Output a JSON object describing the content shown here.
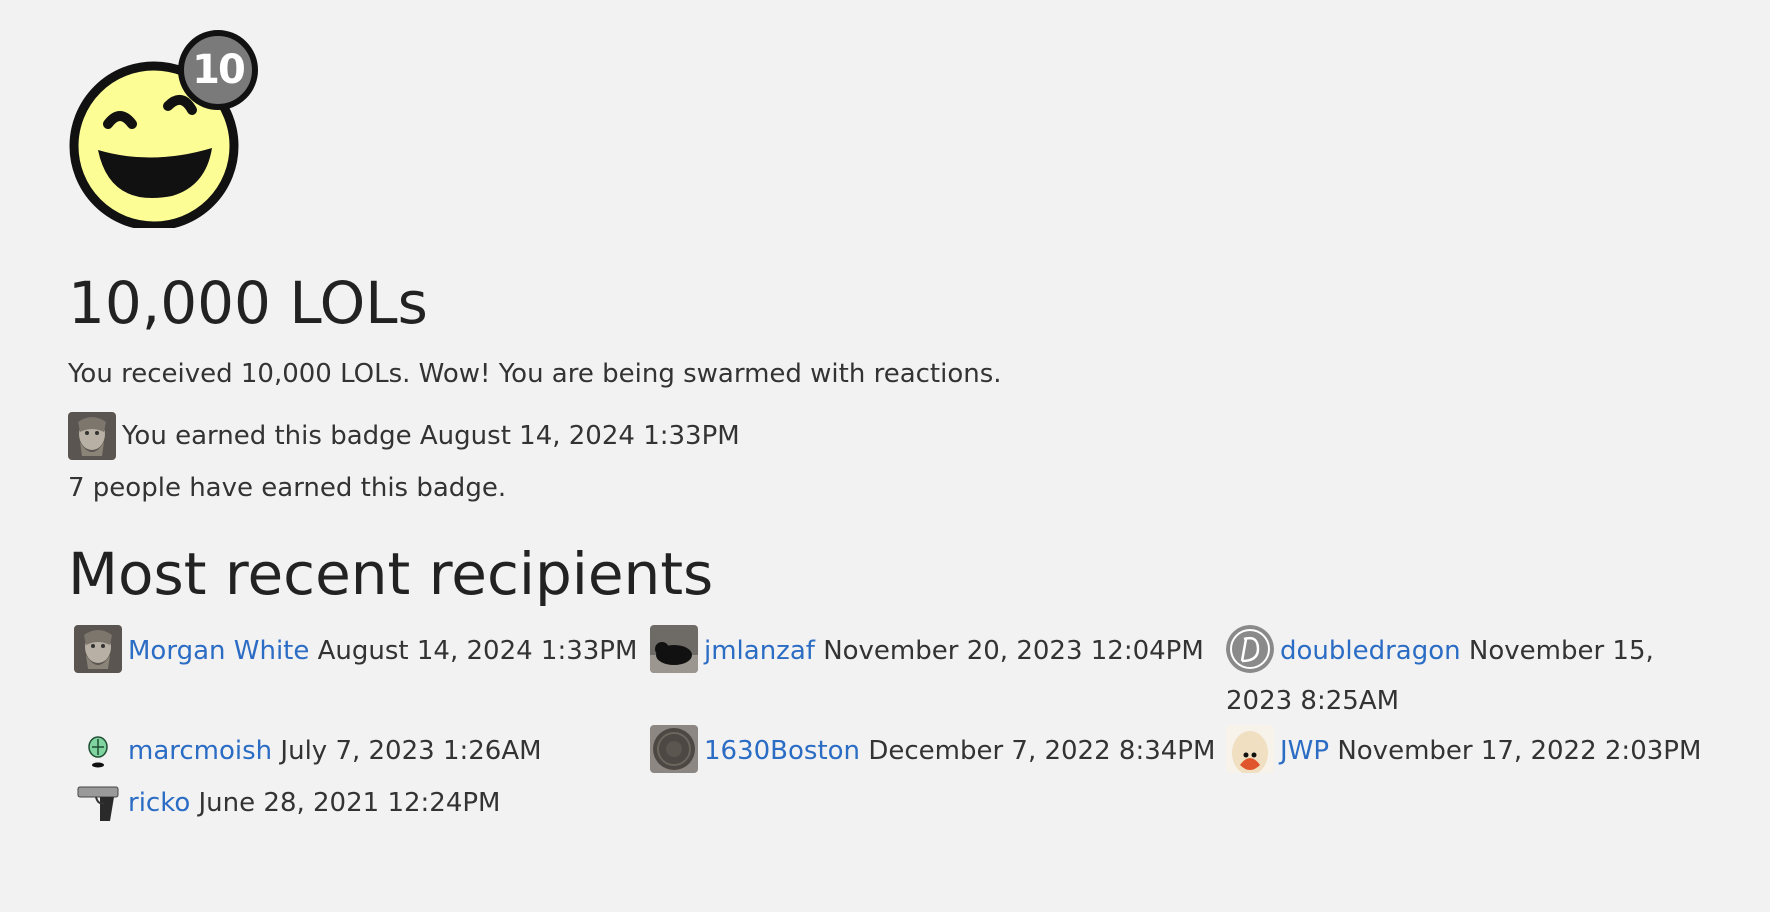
{
  "badge": {
    "count_label": "10",
    "title": "10,000 LOLs",
    "description": "You received 10,000 LOLs. Wow! You are being swarmed with reactions.",
    "earned_text": "You earned this badge August 14, 2024 1:33PM",
    "people_count_text": "7 people have earned this badge."
  },
  "recent": {
    "heading": "Most recent recipients",
    "recipients": [
      {
        "name": "Morgan White",
        "date": "August 14, 2024 1:33PM",
        "avatar": "statue-face-avatar"
      },
      {
        "name": "jmlanzaf",
        "date": "November 20, 2023 12:04PM",
        "avatar": "dog-photo-avatar"
      },
      {
        "name": "doubledragon",
        "date": "November 15, 2023 8:25AM",
        "avatar": "letter-d-avatar"
      },
      {
        "name": "marcmoish",
        "date": "July 7, 2023 1:26AM",
        "avatar": "green-mask-avatar"
      },
      {
        "name": "1630Boston",
        "date": "December 7, 2022 8:34PM",
        "avatar": "coin-avatar"
      },
      {
        "name": "JWP",
        "date": "November 17, 2022 2:03PM",
        "avatar": "cartoon-egg-avatar"
      },
      {
        "name": "ricko",
        "date": "June 28, 2021 12:24PM",
        "avatar": "pistol-avatar"
      }
    ]
  },
  "colors": {
    "background": "#f2f2f2",
    "link": "#2b6cc4",
    "badge_face": "#fdfd96",
    "badge_count_bg": "#7a7a7a"
  }
}
